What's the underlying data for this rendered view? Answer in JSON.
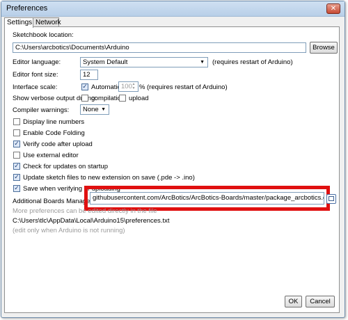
{
  "window": {
    "title": "Preferences",
    "close_glyph": "✕"
  },
  "tabs": [
    {
      "label": "Settings",
      "active": true
    },
    {
      "label": "Network",
      "active": false
    }
  ],
  "sketchbook": {
    "label": "Sketchbook location:",
    "value": "C:\\Users\\arcbotics\\Documents\\Arduino",
    "browse_label": "Browse"
  },
  "editor_language": {
    "label": "Editor language:",
    "value": "System Default",
    "note": "(requires restart of Arduino)"
  },
  "editor_font_size": {
    "label": "Editor font size:",
    "value": "12"
  },
  "interface_scale": {
    "label": "Interface scale:",
    "automatic_label": "Automatic",
    "automatic_checked": true,
    "value": "100",
    "unit": "%",
    "note": "(requires restart of Arduino)"
  },
  "verbose_output": {
    "label": "Show verbose output during:",
    "compilation_label": "compilation",
    "compilation_checked": false,
    "upload_label": "upload",
    "upload_checked": false
  },
  "compiler_warnings": {
    "label": "Compiler warnings:",
    "value": "None"
  },
  "options": [
    {
      "label": "Display line numbers",
      "checked": false
    },
    {
      "label": "Enable Code Folding",
      "checked": false
    },
    {
      "label": "Verify code after upload",
      "checked": true
    },
    {
      "label": "Use external editor",
      "checked": false
    },
    {
      "label": "Check for updates on startup",
      "checked": true
    },
    {
      "label": "Update sketch files to new extension on save (.pde -> .ino)",
      "checked": true
    },
    {
      "label": "Save when verifying or uploading",
      "checked": true
    }
  ],
  "boards_manager": {
    "label": "Additional Boards Manager URLs:",
    "value": "githubusercontent.com/ArcBotics/ArcBotics-Boards/master/package_arcbotics.com_boards_index.json"
  },
  "footer": {
    "more_prefs": "More preferences can be edited directly in the file",
    "prefs_path": "C:\\Users\\tlc\\AppData\\Local\\Arduino15\\preferences.txt",
    "edit_note": "(edit only when Arduino is not running)"
  },
  "buttons": {
    "ok": "OK",
    "cancel": "Cancel"
  },
  "icons": {
    "checkmark": "✓",
    "dropdown": "▼",
    "spinner_up": "▲",
    "spinner_down": "▼"
  },
  "colors": {
    "highlight": "#e01010",
    "title_bar": "#c4d8ee",
    "close_button": "#c74a33"
  }
}
